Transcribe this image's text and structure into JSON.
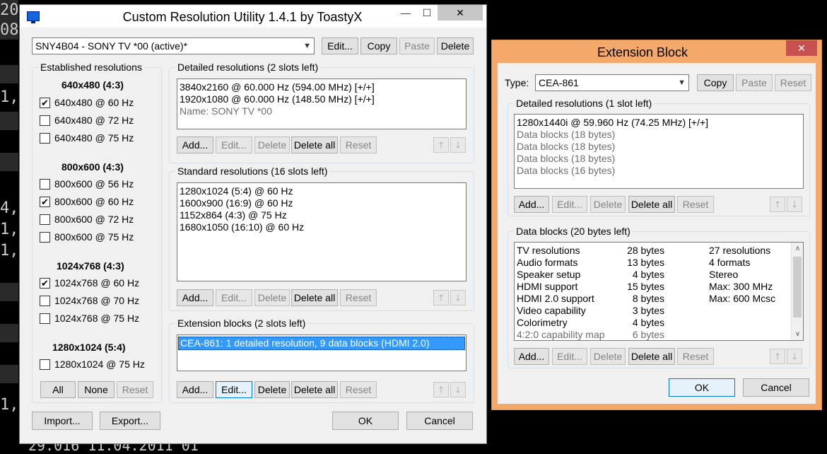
{
  "background_terminal": {
    "lines": [
      "20,",
      "08,",
      "1,",
      "4,",
      "1,",
      "1,",
      "1,"
    ],
    "bottom": "29.016 11.04.2011 01"
  },
  "main_window": {
    "title": "Custom Resolution Utility 1.4.1 by ToastyX",
    "minimize": "—",
    "maximize": "☐",
    "close": "✕",
    "monitor_select": "SNY4B04 - SONY TV  *00 (active)*",
    "top_buttons": {
      "edit": "Edit...",
      "copy": "Copy",
      "paste": "Paste",
      "delete": "Delete"
    },
    "established": {
      "title": "Established resolutions",
      "groups": [
        {
          "heading": "640x480 (4:3)",
          "items": [
            {
              "label": "640x480 @ 60 Hz",
              "checked": "✔"
            },
            {
              "label": "640x480 @ 72 Hz",
              "checked": ""
            },
            {
              "label": "640x480 @ 75 Hz",
              "checked": ""
            }
          ]
        },
        {
          "heading": "800x600 (4:3)",
          "items": [
            {
              "label": "800x600 @ 56 Hz",
              "checked": ""
            },
            {
              "label": "800x600 @ 60 Hz",
              "checked": "✔"
            },
            {
              "label": "800x600 @ 72 Hz",
              "checked": ""
            },
            {
              "label": "800x600 @ 75 Hz",
              "checked": ""
            }
          ]
        },
        {
          "heading": "1024x768 (4:3)",
          "items": [
            {
              "label": "1024x768 @ 60 Hz",
              "checked": "✔"
            },
            {
              "label": "1024x768 @ 70 Hz",
              "checked": ""
            },
            {
              "label": "1024x768 @ 75 Hz",
              "checked": ""
            }
          ]
        },
        {
          "heading": "1280x1024 (5:4)",
          "items": [
            {
              "label": "1280x1024 @ 75 Hz",
              "checked": ""
            }
          ]
        }
      ],
      "buttons": {
        "all": "All",
        "none": "None",
        "reset": "Reset"
      }
    },
    "detailed": {
      "title": "Detailed resolutions (2 slots left)",
      "lines": [
        "3840x2160 @ 60.000 Hz (594.00 MHz) [+/+]",
        "1920x1080 @ 60.000 Hz (148.50 MHz) [+/+]",
        "Name: SONY TV  *00"
      ]
    },
    "standard": {
      "title": "Standard resolutions (16 slots left)",
      "lines": [
        "1280x1024 (5:4) @ 60 Hz",
        "1600x900 (16:9) @ 60 Hz",
        "1152x864 (4:3) @ 75 Hz",
        "1680x1050 (16:10) @ 60 Hz"
      ]
    },
    "extension": {
      "title": "Extension blocks (2 slots left)",
      "lines": [
        "CEA-861: 1 detailed resolution, 9 data blocks (HDMI 2.0)"
      ]
    },
    "list_buttons": {
      "add": "Add...",
      "edit": "Edit...",
      "delete": "Delete",
      "delete_all": "Delete all",
      "reset": "Reset"
    },
    "arrows": {
      "up": "🡑",
      "down": "🡓"
    },
    "bottom_buttons": {
      "import": "Import...",
      "export": "Export...",
      "ok": "OK",
      "cancel": "Cancel"
    }
  },
  "ext_window": {
    "title": "Extension Block",
    "close": "✕",
    "type_label": "Type:",
    "type_value": "CEA-861",
    "top_buttons": {
      "copy": "Copy",
      "paste": "Paste",
      "reset": "Reset"
    },
    "detailed": {
      "title": "Detailed resolutions (1 slot left)",
      "lines": [
        "1280x1440i @ 59.960 Hz (74.25 MHz) [+/+]",
        "Data blocks (18 bytes)",
        "Data blocks (18 bytes)",
        "Data blocks (18 bytes)",
        "Data blocks (16 bytes)"
      ]
    },
    "data_blocks": {
      "title": "Data blocks (20 bytes left)",
      "rows": [
        {
          "name": "TV resolutions",
          "bytes": "28 bytes",
          "info": "27 resolutions"
        },
        {
          "name": "Audio formats",
          "bytes": "13 bytes",
          "info": "4 formats"
        },
        {
          "name": "Speaker setup",
          "bytes": "4 bytes",
          "info": "Stereo"
        },
        {
          "name": "HDMI support",
          "bytes": "15 bytes",
          "info": "Max: 300 MHz"
        },
        {
          "name": "HDMI 2.0 support",
          "bytes": "8 bytes",
          "info": "Max: 600 Mcsc"
        },
        {
          "name": "Video capability",
          "bytes": "3 bytes",
          "info": ""
        },
        {
          "name": "Colorimetry",
          "bytes": "4 bytes",
          "info": ""
        },
        {
          "name": "4:2:0 capability map",
          "bytes": "6 bytes",
          "info": ""
        }
      ],
      "scroll_up": "∧",
      "scroll_down": "∨"
    },
    "list_buttons": {
      "add": "Add...",
      "edit": "Edit...",
      "delete": "Delete",
      "delete_all": "Delete all",
      "reset": "Reset"
    },
    "bottom_buttons": {
      "ok": "OK",
      "cancel": "Cancel"
    }
  }
}
